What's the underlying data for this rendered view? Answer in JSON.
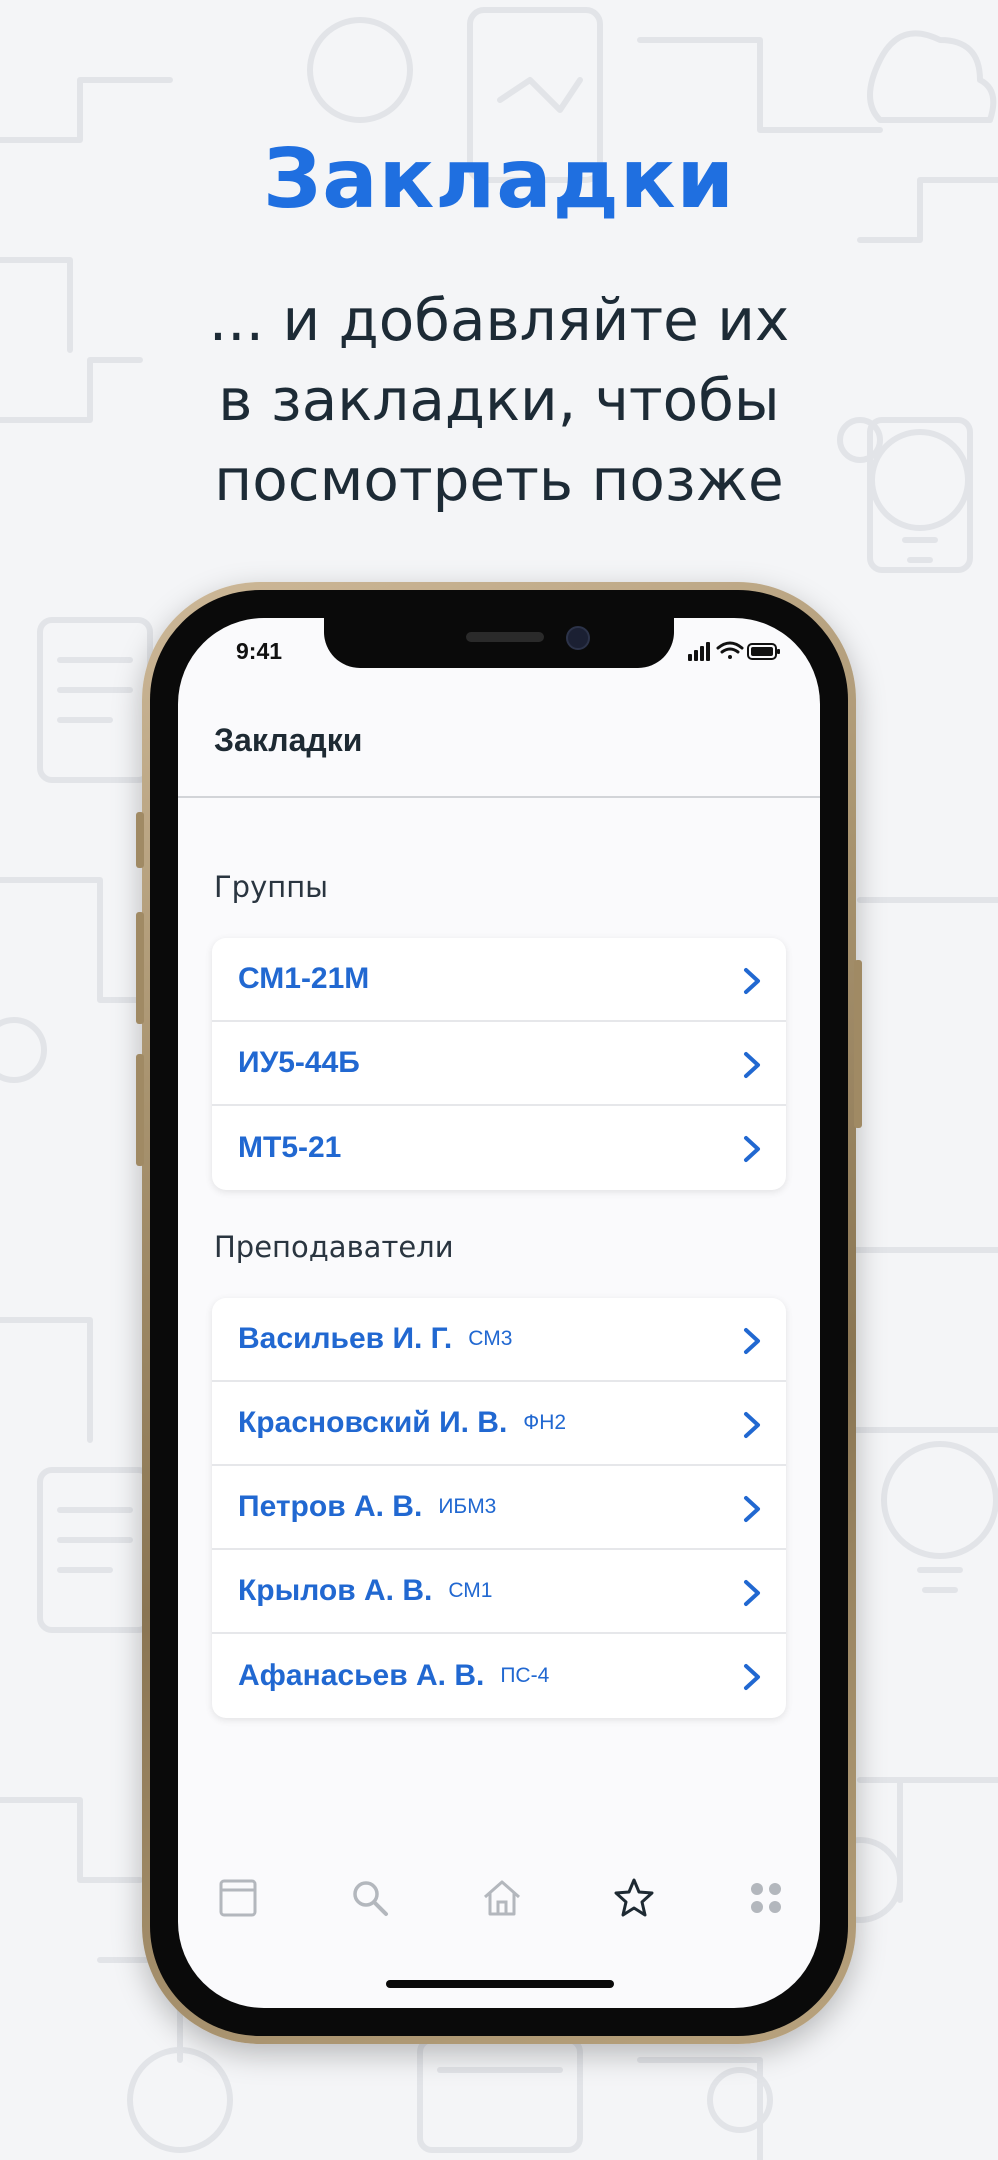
{
  "promo": {
    "title": "Закладки",
    "subtitle_lines": [
      "... и добавляйте их",
      "в закладки, чтобы",
      "посмотреть позже"
    ]
  },
  "status_bar": {
    "time": "9:41"
  },
  "screen": {
    "title": "Закладки",
    "groups": {
      "heading": "Группы",
      "items": [
        {
          "label": "СМ1-21М"
        },
        {
          "label": "ИУ5-44Б"
        },
        {
          "label": "МТ5-21"
        }
      ]
    },
    "teachers": {
      "heading": "Преподаватели",
      "items": [
        {
          "name": "Васильев И. Г.",
          "dept": "СМ3"
        },
        {
          "name": "Красновский И. В.",
          "dept": "ФН2"
        },
        {
          "name": "Петров А. В.",
          "dept": "ИБМ3"
        },
        {
          "name": "Крылов А. В.",
          "dept": "СМ1"
        },
        {
          "name": "Афанасьев А. В.",
          "dept": "ПС-4"
        }
      ]
    }
  },
  "tab_bar": {
    "tabs": [
      {
        "icon": "schedule-icon",
        "active": false
      },
      {
        "icon": "search-icon",
        "active": false
      },
      {
        "icon": "home-icon",
        "active": false
      },
      {
        "icon": "star-icon",
        "active": true
      },
      {
        "icon": "more-icon",
        "active": false
      }
    ]
  },
  "colors": {
    "accent": "#1f6fe0",
    "link": "#2168d1",
    "text_dark": "#1d2b36"
  }
}
